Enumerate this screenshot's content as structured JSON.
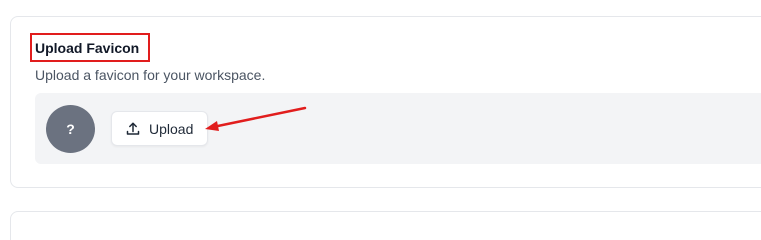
{
  "favicon_section": {
    "title": "Upload Favicon",
    "description": "Upload a favicon for your workspace.",
    "avatar_placeholder": "?",
    "upload_button_label": "Upload",
    "upload_icon": "upload-icon"
  },
  "annotation": {
    "highlight_color": "#e11d1d",
    "arrow_color": "#e11d1d"
  },
  "colors": {
    "avatar_bg": "#6b7280",
    "panel_bg": "#f3f4f6",
    "card_border": "#e5e7eb"
  }
}
